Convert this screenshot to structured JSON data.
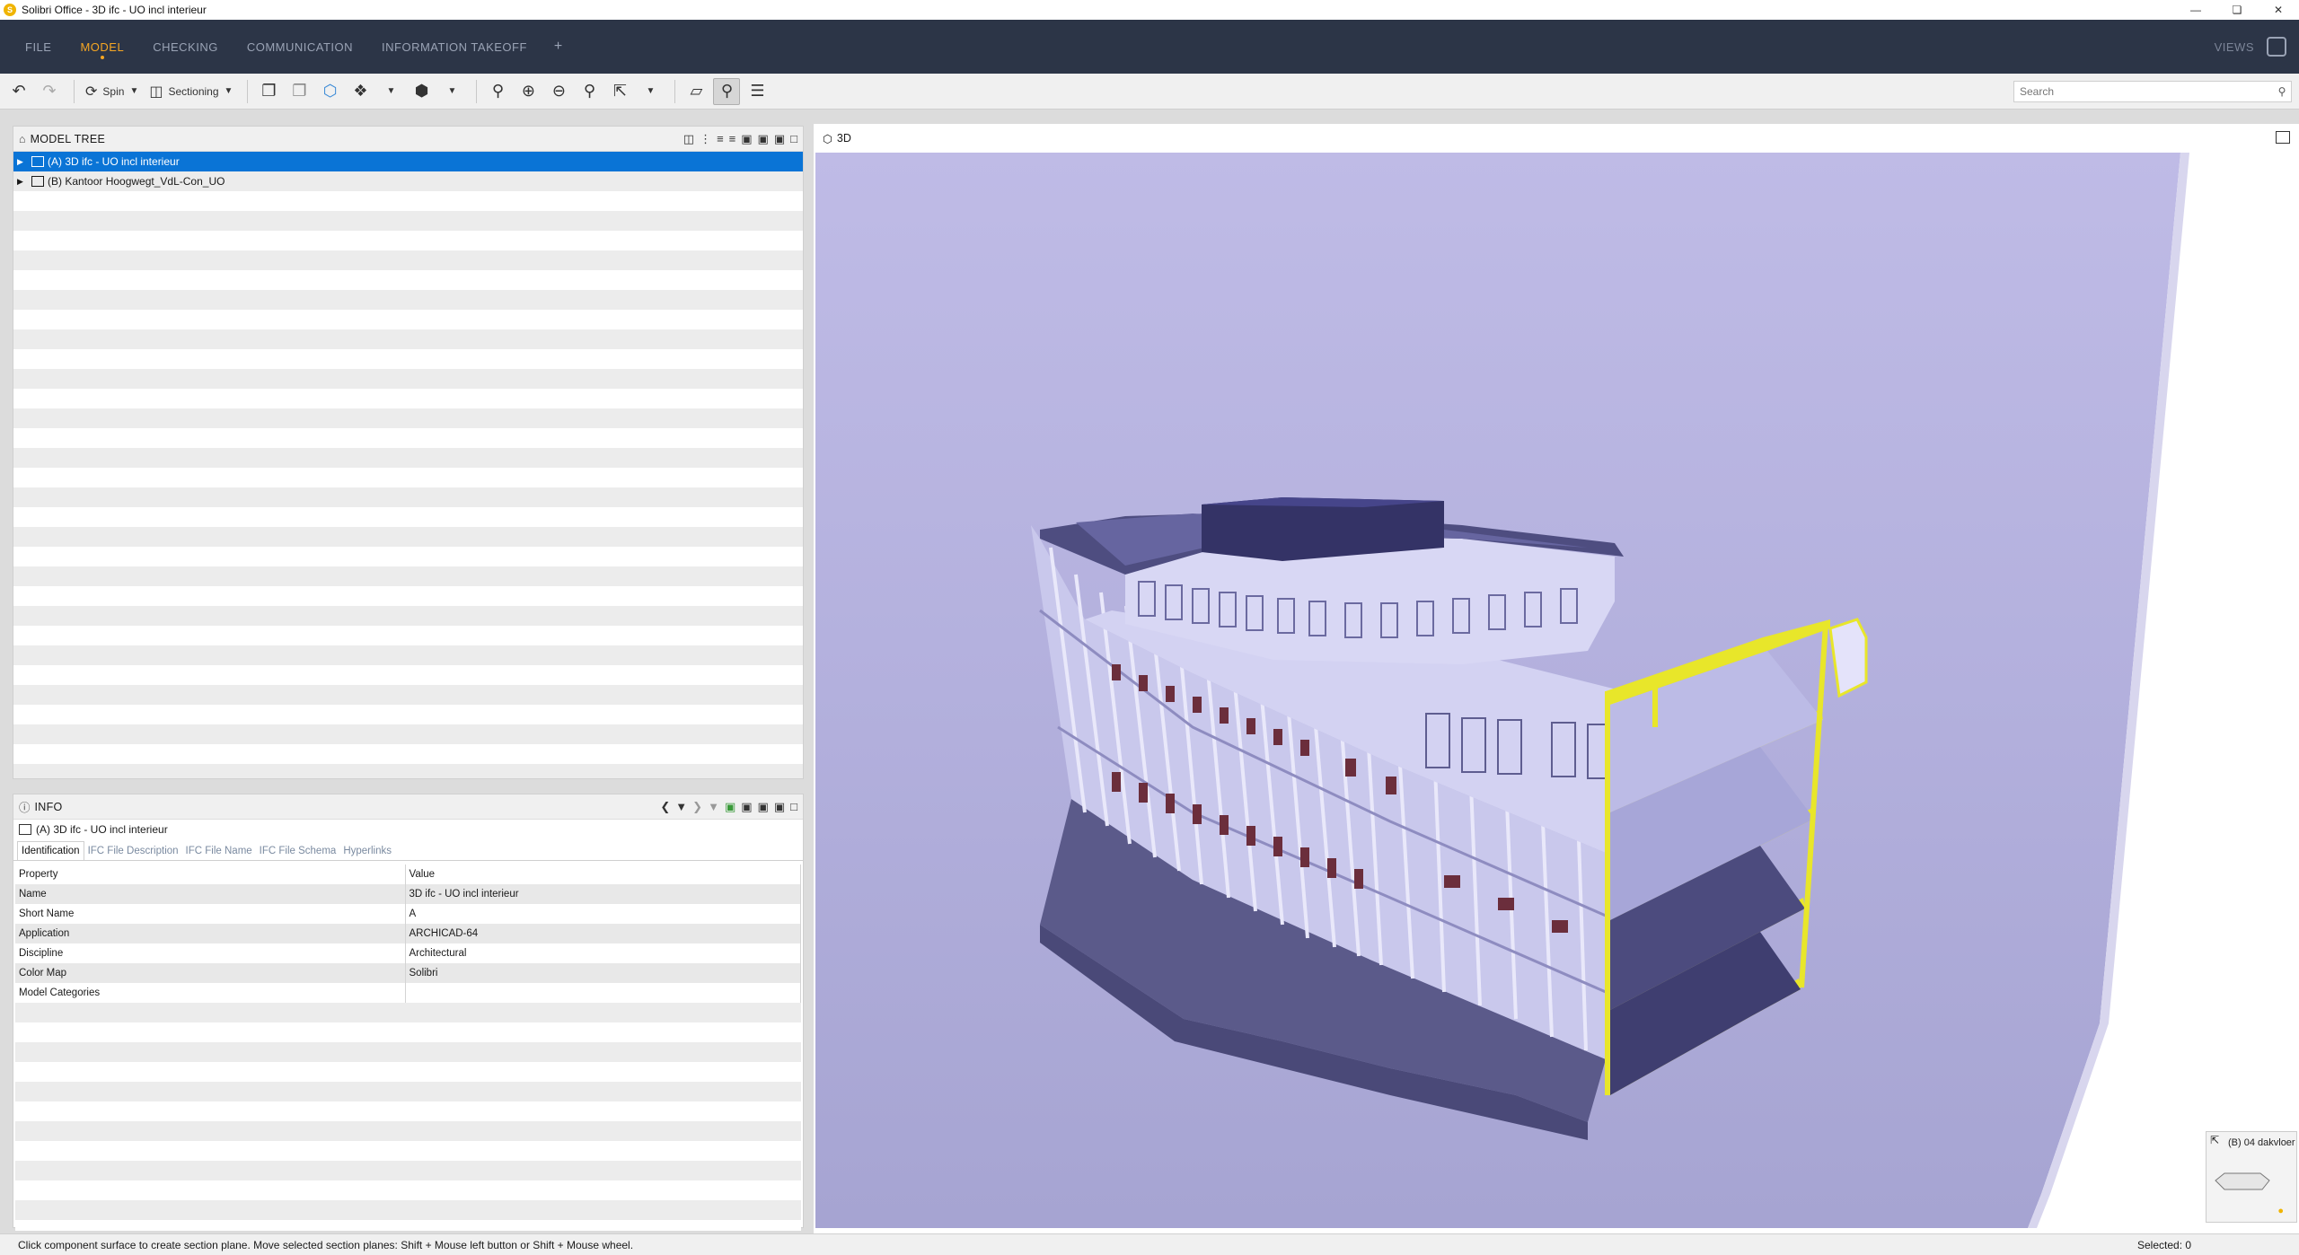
{
  "window": {
    "title": "Solibri Office - 3D ifc - UO incl interieur",
    "icon": "solibri-logo-icon"
  },
  "menu": {
    "items": [
      "FILE",
      "MODEL",
      "CHECKING",
      "COMMUNICATION",
      "INFORMATION TAKEOFF"
    ],
    "active": "MODEL",
    "plus": "+",
    "views": "VIEWS"
  },
  "toolbar": {
    "spin_label": "Spin",
    "sectioning_label": "Sectioning",
    "search_placeholder": "Search"
  },
  "model_tree": {
    "title": "MODEL TREE",
    "rows": [
      {
        "label": "(A) 3D ifc - UO incl interieur",
        "selected": true
      },
      {
        "label": "(B) Kantoor Hoogwegt_VdL-Con_UO",
        "selected": false
      }
    ]
  },
  "info": {
    "title": "INFO",
    "object": "(A) 3D ifc - UO incl interieur",
    "tabs": [
      "Identification",
      "IFC File Description",
      "IFC File Name",
      "IFC File Schema",
      "Hyperlinks"
    ],
    "active_tab": "Identification",
    "columns": [
      "Property",
      "Value"
    ],
    "rows": [
      {
        "property": "Name",
        "value": "3D ifc - UO incl interieur"
      },
      {
        "property": "Short Name",
        "value": "A"
      },
      {
        "property": "Application",
        "value": "ARCHICAD-64"
      },
      {
        "property": "Discipline",
        "value": "Architectural"
      },
      {
        "property": "Color Map",
        "value": "Solibri"
      },
      {
        "property": "Model Categories",
        "value": ""
      }
    ]
  },
  "view3d": {
    "title": "3D",
    "minimap_label": "(B) 04 dakvloer"
  },
  "status": {
    "message": "Click component surface to create section plane. Move selected section planes: Shift + Mouse left button or Shift + Mouse wheel.",
    "selected": "Selected: 0"
  },
  "colors": {
    "menu_bg": "#2c3547",
    "menu_active": "#f5a623",
    "selection": "#0a74d6",
    "section_highlight": "#e8e62a",
    "viewport_bg": "#b3b0dd"
  }
}
